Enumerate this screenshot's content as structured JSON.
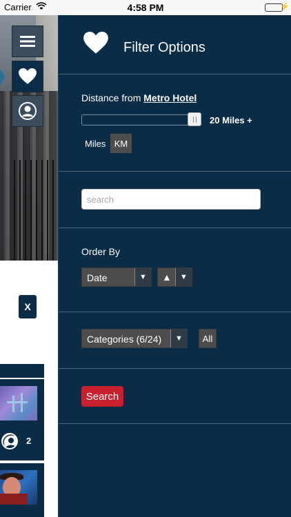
{
  "status_bar": {
    "carrier": "Carrier",
    "time": "4:58 PM"
  },
  "sidebar": {
    "active_item": "favorites"
  },
  "list_panel": {
    "close_label": "X",
    "card_count": "2"
  },
  "filter_panel": {
    "title": "Filter Options",
    "distance_prefix": "Distance from",
    "distance_place": "Metro Hotel",
    "distance_value": "20 Miles +",
    "distance_fraction": 1.0,
    "unit_miles": "Miles",
    "unit_km": "KM",
    "search_placeholder": "search",
    "search_value": "",
    "order_by_label": "Order By",
    "order_by_value": "Date",
    "sort_direction": "▲",
    "categories_value": "Categories (6/24)",
    "all_label": "All",
    "search_button": "Search"
  },
  "colors": {
    "panel_bg": "#0a2c47",
    "search_button": "#c8202e",
    "select_bg": "#4d4d4d"
  }
}
